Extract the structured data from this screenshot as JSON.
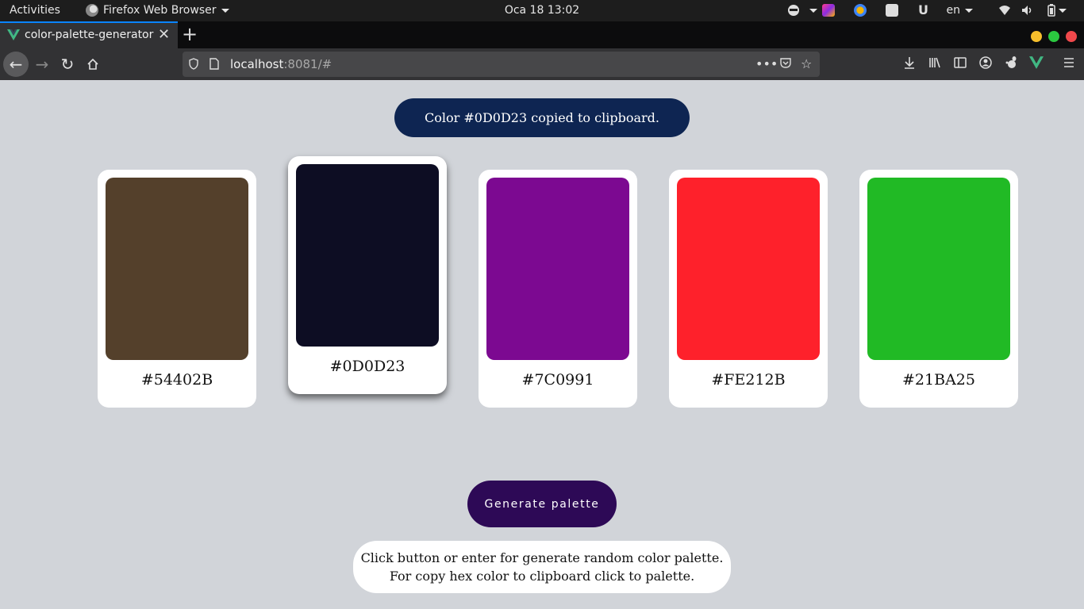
{
  "system_bar": {
    "activities": "Activities",
    "app_name": "Firefox Web Browser",
    "clock": "Oca 18  13:02",
    "language": "en"
  },
  "browser": {
    "tab_title": "color-palette-generator",
    "url_host": "localhost",
    "url_rest": ":8081/#"
  },
  "toast": {
    "text": "Color #0D0D23 copied to clipboard."
  },
  "palette": [
    {
      "hex": "#54402B",
      "color": "#54402B"
    },
    {
      "hex": "#0D0D23",
      "color": "#0D0D23"
    },
    {
      "hex": "#7C0991",
      "color": "#7C0991"
    },
    {
      "hex": "#FE212B",
      "color": "#FE212B"
    },
    {
      "hex": "#21BA25",
      "color": "#21BA25"
    }
  ],
  "generate_button": {
    "label": "Generate palette"
  },
  "hint": {
    "line1": "Click button or enter for generate random color palette.",
    "line2": "For copy hex color to clipboard click to palette."
  },
  "colors": {
    "page_background": "#D1D4D9",
    "toast_background": "#0E2552",
    "button_background": "#2D0956",
    "active_tab_accent": "#0A84FF"
  }
}
